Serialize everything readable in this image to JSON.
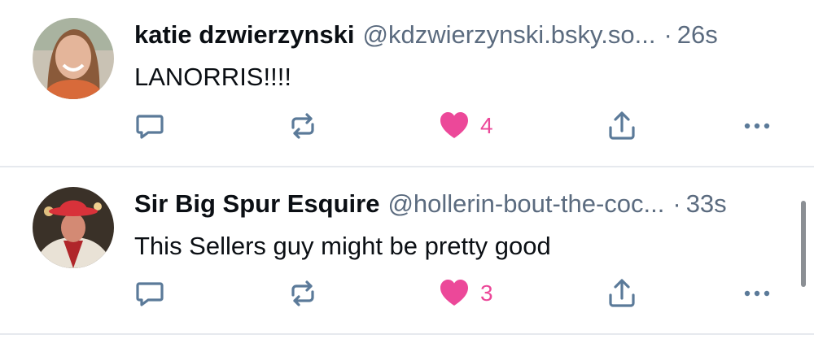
{
  "posts": [
    {
      "author": "katie dzwierzynski",
      "handle": "@kdzwierzynski.bsky.so...",
      "separator": "·",
      "time": "26s",
      "text": "LANORRIS!!!!",
      "likes": "4"
    },
    {
      "author": "Sir Big Spur Esquire",
      "handle": "@hollerin-bout-the-coc...",
      "separator": "·",
      "time": "33s",
      "text": "This Sellers guy might be pretty good",
      "likes": "3"
    }
  ],
  "colors": {
    "like": "#ec4899",
    "icon": "#5b7a99",
    "muted": "#5b6b7f",
    "divider": "#e6e9ee"
  },
  "icons": [
    "reply-icon",
    "repost-icon",
    "heart-icon",
    "share-icon",
    "more-icon"
  ]
}
